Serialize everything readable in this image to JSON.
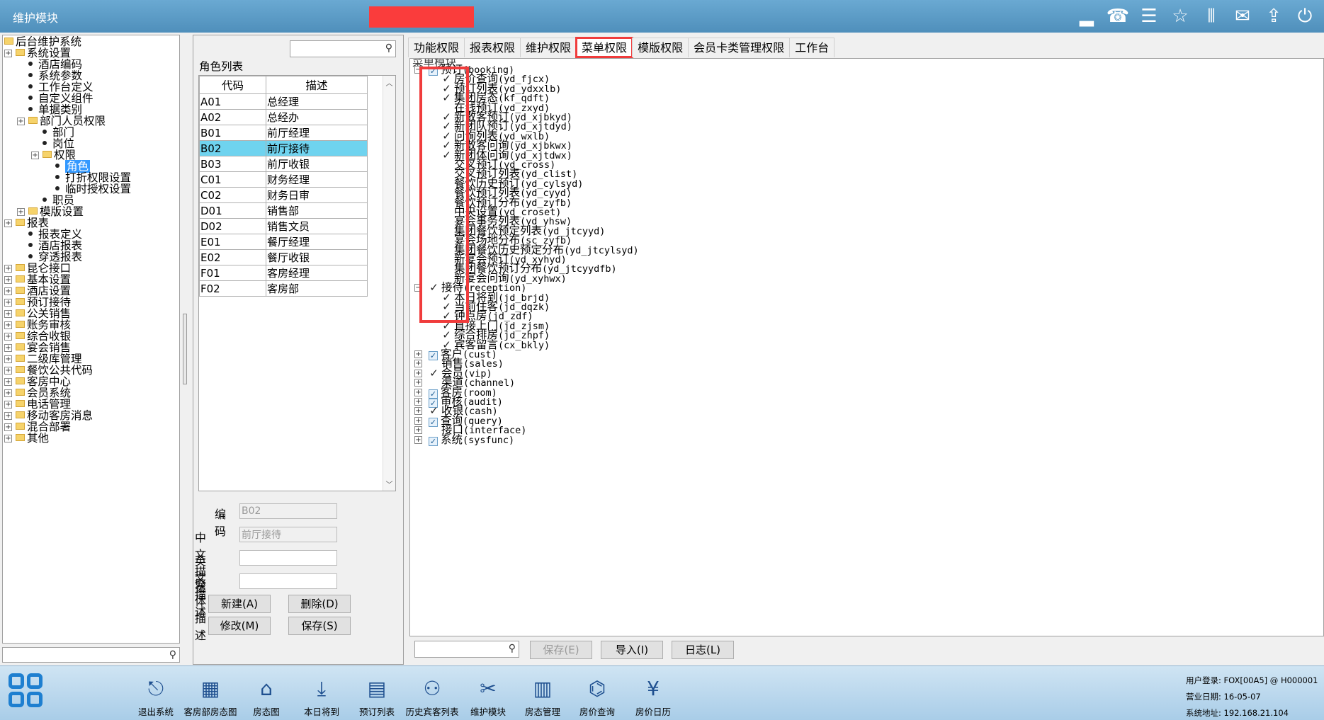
{
  "window": {
    "title": "维护模块"
  },
  "titlebar_icons": [
    "signal-icon",
    "phone-icon",
    "menu-icon",
    "star-icon",
    "columns-icon",
    "mail-icon",
    "up-icon",
    "power-icon"
  ],
  "left_tree": {
    "root": "后台维护系统",
    "items": [
      {
        "label": "系统设置",
        "type": "folder",
        "level": 1
      },
      {
        "label": "酒店编码",
        "type": "leaf",
        "level": 2
      },
      {
        "label": "系统参数",
        "type": "leaf",
        "level": 2
      },
      {
        "label": "工作台定义",
        "type": "leaf",
        "level": 2
      },
      {
        "label": "自定义组件",
        "type": "leaf",
        "level": 2
      },
      {
        "label": "单据类别",
        "type": "leaf",
        "level": 2
      },
      {
        "label": "部门人员权限",
        "type": "folder",
        "level": 2
      },
      {
        "label": "部门",
        "type": "leaf",
        "level": 3
      },
      {
        "label": "岗位",
        "type": "leaf",
        "level": 3
      },
      {
        "label": "权限",
        "type": "folder",
        "level": 3
      },
      {
        "label": "角色",
        "type": "leaf",
        "level": 4,
        "selected": true
      },
      {
        "label": "打折权限设置",
        "type": "leaf",
        "level": 4
      },
      {
        "label": "临时授权设置",
        "type": "leaf",
        "level": 4
      },
      {
        "label": "职员",
        "type": "leaf",
        "level": 3
      },
      {
        "label": "模版设置",
        "type": "folder",
        "level": 2
      },
      {
        "label": "报表",
        "type": "folder",
        "level": 1
      },
      {
        "label": "报表定义",
        "type": "leaf",
        "level": 2
      },
      {
        "label": "酒店报表",
        "type": "leaf",
        "level": 2
      },
      {
        "label": "穿透报表",
        "type": "leaf",
        "level": 2
      },
      {
        "label": "昆仑接口",
        "type": "folder",
        "level": 1
      },
      {
        "label": "基本设置",
        "type": "folder",
        "level": 1
      },
      {
        "label": "酒店设置",
        "type": "folder",
        "level": 1
      },
      {
        "label": "预订接待",
        "type": "folder",
        "level": 1
      },
      {
        "label": "公关销售",
        "type": "folder",
        "level": 1
      },
      {
        "label": "账务审核",
        "type": "folder",
        "level": 1
      },
      {
        "label": "综合收银",
        "type": "folder",
        "level": 1
      },
      {
        "label": "宴会销售",
        "type": "folder",
        "level": 1
      },
      {
        "label": "二级库管理",
        "type": "folder",
        "level": 1
      },
      {
        "label": "餐饮公共代码",
        "type": "folder",
        "level": 1
      },
      {
        "label": "客房中心",
        "type": "folder",
        "level": 1
      },
      {
        "label": "会员系统",
        "type": "folder",
        "level": 1
      },
      {
        "label": "电话管理",
        "type": "folder",
        "level": 1
      },
      {
        "label": "移动客房消息",
        "type": "folder",
        "level": 1
      },
      {
        "label": "混合部署",
        "type": "folder",
        "level": 1
      },
      {
        "label": "其他",
        "type": "folder",
        "level": 1
      }
    ]
  },
  "roles": {
    "label": "角色列表",
    "headers": [
      "代码",
      "描述"
    ],
    "rows": [
      [
        "A01",
        "总经理"
      ],
      [
        "A02",
        "总经办"
      ],
      [
        "B01",
        "前厅经理"
      ],
      [
        "B02",
        "前厅接待"
      ],
      [
        "B03",
        "前厅收银"
      ],
      [
        "C01",
        "财务经理"
      ],
      [
        "C02",
        "财务日审"
      ],
      [
        "D01",
        "销售部"
      ],
      [
        "D02",
        "销售文员"
      ],
      [
        "E01",
        "餐厅经理"
      ],
      [
        "E02",
        "餐厅收银"
      ],
      [
        "F01",
        "客房经理"
      ],
      [
        "F02",
        "客房部"
      ]
    ],
    "selected_index": 3
  },
  "form": {
    "code_label": "编码",
    "code_value": "B02",
    "cn_label": "中文描述",
    "cn_value": "前厅接待",
    "en_label": "英文描述",
    "en_value": "",
    "tw_label": "繁体描述",
    "tw_value": "",
    "new_btn": "新建(A)",
    "delete_btn": "删除(D)",
    "modify_btn": "修改(M)",
    "save_btn": "保存(S)"
  },
  "tabs": [
    "功能权限",
    "报表权限",
    "维护权限",
    "菜单权限",
    "模版权限",
    "会员卡类管理权限",
    "工作台"
  ],
  "active_tab": "菜单权限",
  "menu_tree": {
    "header": "菜单模块",
    "booking_root": {
      "label": "预订",
      "code": "(booking)"
    },
    "booking_children": [
      {
        "label": "房价查询",
        "code": "(yd_fjcx)",
        "checked": true
      },
      {
        "label": "预订列表",
        "code": "(yd_ydxxlb)",
        "checked": true
      },
      {
        "label": "集团房态",
        "code": "(kf_qdft)",
        "checked": true
      },
      {
        "label": "在线预订",
        "code": "(yd_zxyd)",
        "checked": false
      },
      {
        "label": "新散客预订",
        "code": "(yd_xjbkyd)",
        "checked": true
      },
      {
        "label": "新团队预订",
        "code": "(yd_xjtdyd)",
        "checked": true
      },
      {
        "label": "问询列表",
        "code": "(yd_wxlb)",
        "checked": true
      },
      {
        "label": "新散客问询",
        "code": "(yd_xjbkwx)",
        "checked": true
      },
      {
        "label": "新团体问询",
        "code": "(yd_xjtdwx)",
        "checked": true
      },
      {
        "label": "交叉预订",
        "code": "(yd_cross)",
        "checked": false
      },
      {
        "label": "交叉预订列表",
        "code": "(yd_clist)",
        "checked": false
      },
      {
        "label": "餐饮历史预订",
        "code": "(yd_cylsyd)",
        "checked": false
      },
      {
        "label": "餐饮预订列表",
        "code": "(yd_cyyd)",
        "checked": false
      },
      {
        "label": "餐饮预订分布",
        "code": "(yd_zyfb)",
        "checked": false
      },
      {
        "label": "中央设置",
        "code": "(yd_croset)",
        "checked": false
      },
      {
        "label": "宴会事务列表",
        "code": "(yd_yhsw)",
        "checked": false
      },
      {
        "label": "集团餐饮预定列表",
        "code": "(yd_jtcyyd)",
        "checked": false
      },
      {
        "label": "宴会场地分布",
        "code": "(sc_zyfb)",
        "checked": false
      },
      {
        "label": "集团餐饮历史预定分布",
        "code": "(yd_jtcylsyd)",
        "checked": false
      },
      {
        "label": "新宴会预订",
        "code": "(yd_xyhyd)",
        "checked": false
      },
      {
        "label": "集团餐饮预订分布",
        "code": "(yd_jtcyydfb)",
        "checked": false
      },
      {
        "label": "新宴会问询",
        "code": "(yd_xyhwx)",
        "checked": false
      }
    ],
    "reception_root": {
      "label": "接待",
      "code": "(reception)"
    },
    "reception_children": [
      {
        "label": "本日将到",
        "code": "(jd_brjd)",
        "checked": true
      },
      {
        "label": "当前住客",
        "code": "(jd_dqzk)",
        "checked": true
      },
      {
        "label": "钟点房",
        "code": "(jd_zdf)",
        "checked": true
      },
      {
        "label": "直接上门",
        "code": "(jd_zjsm)",
        "checked": true
      },
      {
        "label": "综合排房",
        "code": "(jd_zhpf)",
        "checked": true
      },
      {
        "label": "宾客留言",
        "code": "(cx_bkly)",
        "checked": true
      }
    ],
    "collapsed": [
      {
        "label": "客户",
        "code": "(cust)",
        "state": "partial"
      },
      {
        "label": "销售",
        "code": "(sales)",
        "state": "none"
      },
      {
        "label": "会员",
        "code": "(vip)",
        "state": "checked"
      },
      {
        "label": "渠道",
        "code": "(channel)",
        "state": "none"
      },
      {
        "label": "客房",
        "code": "(room)",
        "state": "partial"
      },
      {
        "label": "审核",
        "code": "(audit)",
        "state": "partial"
      },
      {
        "label": "收银",
        "code": "(cash)",
        "state": "checked"
      },
      {
        "label": "查询",
        "code": "(query)",
        "state": "partial"
      },
      {
        "label": "接口",
        "code": "(interface)",
        "state": "none"
      },
      {
        "label": "系统",
        "code": "(sysfunc)",
        "state": "partial"
      }
    ]
  },
  "bottom_toolbar": {
    "save": "保存(E)",
    "import": "导入(I)",
    "log": "日志(L)"
  },
  "taskbar": [
    {
      "label": "退出系统",
      "icon": "exit-icon"
    },
    {
      "label": "客房部房态图",
      "icon": "room-status-icon"
    },
    {
      "label": "房态图",
      "icon": "house-icon"
    },
    {
      "label": "本日将到",
      "icon": "arrival-icon"
    },
    {
      "label": "预订列表",
      "icon": "booking-list-icon"
    },
    {
      "label": "历史宾客列表",
      "icon": "guest-history-icon"
    },
    {
      "label": "维护模块",
      "icon": "tools-icon"
    },
    {
      "label": "房态管理",
      "icon": "room-manage-icon"
    },
    {
      "label": "房价查询",
      "icon": "price-query-icon"
    },
    {
      "label": "房价日历",
      "icon": "price-calendar-icon"
    }
  ],
  "status": {
    "user": "用户登录: FOX[00A5] @ H000001",
    "date": "营业日期: 16-05-07",
    "addr": "系统地址: 192.168.21.104"
  }
}
